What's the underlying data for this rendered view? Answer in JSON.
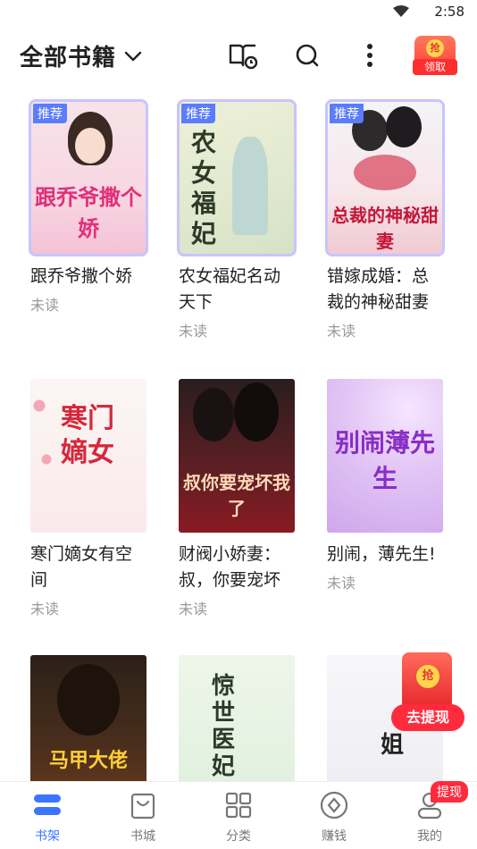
{
  "status_bar": {
    "time": "2:58"
  },
  "header": {
    "title": "全部书籍",
    "reward_label": "领取",
    "reward_coin": "抢"
  },
  "books": [
    {
      "title": "跟乔爷撒个娇",
      "status": "未读",
      "badge": "推荐",
      "cover_title": "跟乔爷撒个娇"
    },
    {
      "title": "农女福妃名动天下",
      "status": "未读",
      "badge": "推荐",
      "cover_title": "农女福妃"
    },
    {
      "title": "错嫁成婚：总裁的神秘甜妻",
      "status": "未读",
      "badge": "推荐",
      "cover_title": "总裁的神秘甜妻"
    },
    {
      "title": "寒门嫡女有空间",
      "status": "未读",
      "badge": "",
      "cover_title": "寒门嫡女"
    },
    {
      "title": "财阀小娇妻：叔，你要宠坏",
      "status": "未读",
      "badge": "",
      "cover_title": "叔你要宠坏我了"
    },
    {
      "title": "别闹，薄先生!",
      "status": "未读",
      "badge": "",
      "cover_title": "别闹薄先生"
    },
    {
      "title": "",
      "status": "",
      "badge": "",
      "cover_title": "马甲大佬"
    },
    {
      "title": "",
      "status": "",
      "badge": "",
      "cover_title": "惊世医妃"
    },
    {
      "title": "",
      "status": "",
      "badge": "",
      "cover_title": "姐"
    }
  ],
  "float_reward": {
    "coin": "抢",
    "label": "去提现"
  },
  "bottom_nav": {
    "items": [
      {
        "label": "书架"
      },
      {
        "label": "书城"
      },
      {
        "label": "分类"
      },
      {
        "label": "赚钱"
      },
      {
        "label": "我的"
      }
    ],
    "badge": "提现"
  },
  "colors": {
    "accent": "#3a74ff",
    "badge_blue": "#5b7cff",
    "red": "#ff2b3c"
  }
}
